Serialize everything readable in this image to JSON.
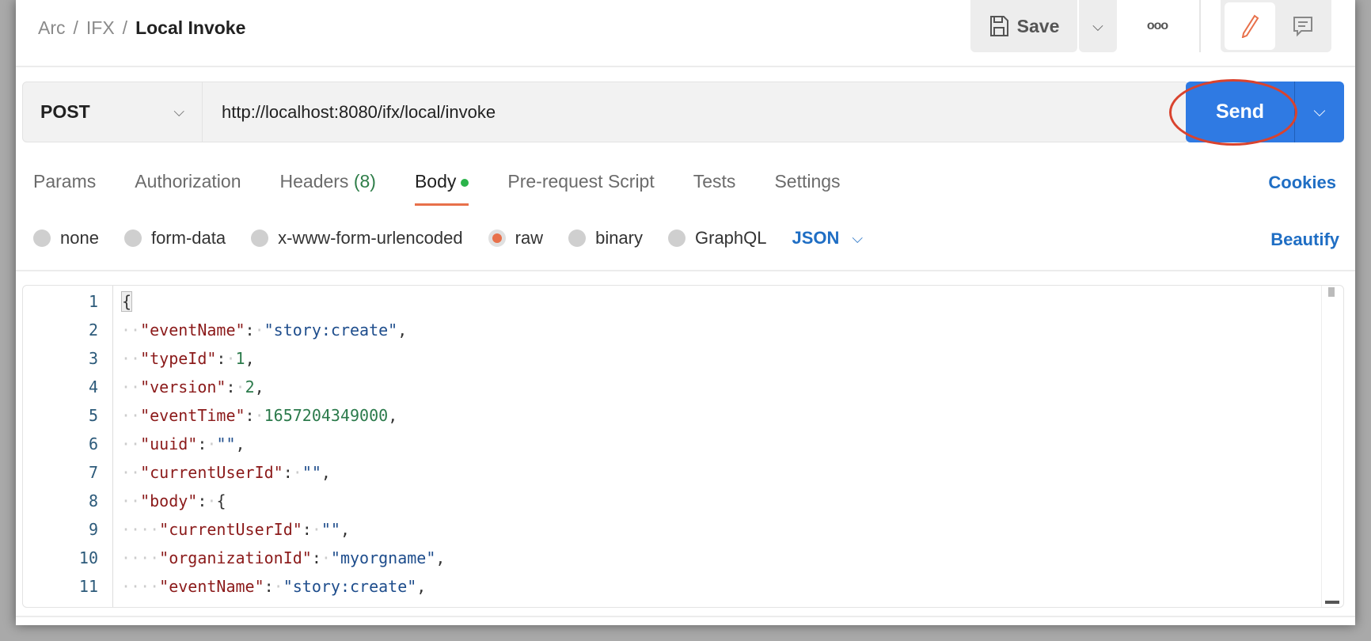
{
  "breadcrumb": {
    "items": [
      "Arc",
      "IFX"
    ],
    "current": "Local Invoke",
    "separator": "/"
  },
  "toolbar": {
    "save_label": "Save",
    "more_label": "ooo"
  },
  "request": {
    "method": "POST",
    "url": "http://localhost:8080/ifx/local/invoke",
    "send_label": "Send"
  },
  "tabs": [
    {
      "label": "Params"
    },
    {
      "label": "Authorization"
    },
    {
      "label": "Headers",
      "count": "(8)"
    },
    {
      "label": "Body",
      "active": true
    },
    {
      "label": "Pre-request Script"
    },
    {
      "label": "Tests"
    },
    {
      "label": "Settings"
    }
  ],
  "cookies_label": "Cookies",
  "body_types": [
    {
      "label": "none"
    },
    {
      "label": "form-data"
    },
    {
      "label": "x-www-form-urlencoded"
    },
    {
      "label": "raw",
      "selected": true
    },
    {
      "label": "binary"
    },
    {
      "label": "GraphQL"
    }
  ],
  "format": "JSON",
  "beautify_label": "Beautify",
  "editor": {
    "lines": [
      [
        [
          "p",
          "{"
        ]
      ],
      [
        [
          "w",
          "··"
        ],
        [
          "k",
          "\"eventName\""
        ],
        [
          "p",
          ":"
        ],
        [
          "w",
          "·"
        ],
        [
          "s",
          "\"story:create\""
        ],
        [
          "p",
          ","
        ]
      ],
      [
        [
          "w",
          "··"
        ],
        [
          "k",
          "\"typeId\""
        ],
        [
          "p",
          ":"
        ],
        [
          "w",
          "·"
        ],
        [
          "n",
          "1"
        ],
        [
          "p",
          ","
        ]
      ],
      [
        [
          "w",
          "··"
        ],
        [
          "k",
          "\"version\""
        ],
        [
          "p",
          ":"
        ],
        [
          "w",
          "·"
        ],
        [
          "n",
          "2"
        ],
        [
          "p",
          ","
        ]
      ],
      [
        [
          "w",
          "··"
        ],
        [
          "k",
          "\"eventTime\""
        ],
        [
          "p",
          ":"
        ],
        [
          "w",
          "·"
        ],
        [
          "n",
          "1657204349000"
        ],
        [
          "p",
          ","
        ]
      ],
      [
        [
          "w",
          "··"
        ],
        [
          "k",
          "\"uuid\""
        ],
        [
          "p",
          ":"
        ],
        [
          "w",
          "·"
        ],
        [
          "s",
          "\"\""
        ],
        [
          "p",
          ","
        ]
      ],
      [
        [
          "w",
          "··"
        ],
        [
          "k",
          "\"currentUserId\""
        ],
        [
          "p",
          ":"
        ],
        [
          "w",
          "·"
        ],
        [
          "s",
          "\"\""
        ],
        [
          "p",
          ","
        ]
      ],
      [
        [
          "w",
          "··"
        ],
        [
          "k",
          "\"body\""
        ],
        [
          "p",
          ":"
        ],
        [
          "w",
          "·"
        ],
        [
          "p",
          "{"
        ]
      ],
      [
        [
          "w",
          "····"
        ],
        [
          "k",
          "\"currentUserId\""
        ],
        [
          "p",
          ":"
        ],
        [
          "w",
          "·"
        ],
        [
          "s",
          "\"\""
        ],
        [
          "p",
          ","
        ]
      ],
      [
        [
          "w",
          "····"
        ],
        [
          "k",
          "\"organizationId\""
        ],
        [
          "p",
          ":"
        ],
        [
          "w",
          "·"
        ],
        [
          "s",
          "\"myorgname\""
        ],
        [
          "p",
          ","
        ]
      ],
      [
        [
          "w",
          "····"
        ],
        [
          "k",
          "\"eventName\""
        ],
        [
          "p",
          ":"
        ],
        [
          "w",
          "·"
        ],
        [
          "s",
          "\"story:create\""
        ],
        [
          "p",
          ","
        ]
      ]
    ]
  },
  "colors": {
    "accent": "#2f7ae3",
    "tab_underline": "#e8704a",
    "key": "#8b1a1a",
    "string": "#1e4d8c",
    "number": "#2b7a4b"
  }
}
